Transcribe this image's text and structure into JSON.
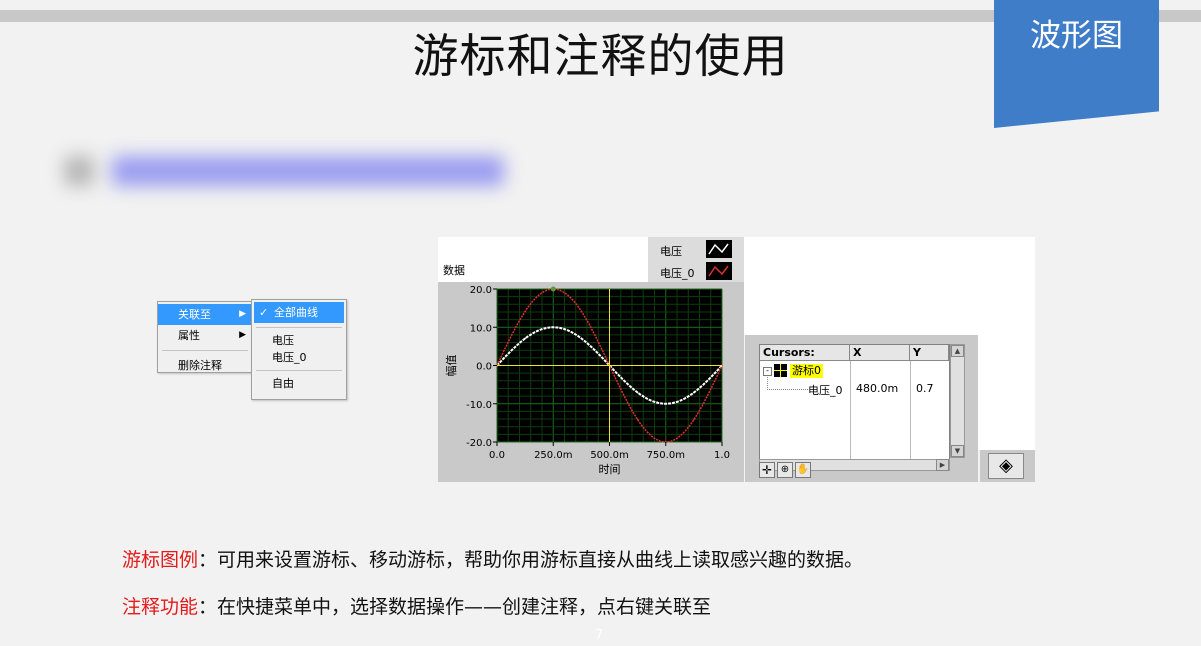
{
  "slide": {
    "title": "游标和注释的使用",
    "tag": "波形图",
    "page_number": "7"
  },
  "context_menu": {
    "items": [
      "关联至",
      "属性",
      "删除注释"
    ],
    "submenu": [
      "全部曲线",
      "电压",
      "电压_0",
      "自由"
    ]
  },
  "graph": {
    "data_label": "数据",
    "legend": [
      {
        "name": "电压",
        "color": "#ffffff"
      },
      {
        "name": "电压_0",
        "color": "#e03030"
      }
    ],
    "x_label": "时间",
    "y_label": "幅值",
    "y_ticks": [
      "20.0",
      "10.0",
      "0.0",
      "-10.0",
      "-20.0"
    ],
    "x_ticks": [
      "0.0",
      "250.0m",
      "500.0m",
      "750.0m",
      "1.0"
    ]
  },
  "chart_data": {
    "type": "line",
    "xlabel": "时间",
    "ylabel": "幅值",
    "xlim": [
      0,
      1
    ],
    "ylim": [
      -20,
      20
    ],
    "grid": true,
    "series": [
      {
        "name": "电压",
        "x": [
          0,
          0.125,
          0.25,
          0.375,
          0.5,
          0.625,
          0.75,
          0.875,
          1.0
        ],
        "values": [
          0,
          7.1,
          10,
          7.1,
          0,
          -7.1,
          -10,
          -7.1,
          0
        ],
        "color": "#ffffff"
      },
      {
        "name": "电压_0",
        "x": [
          0,
          0.125,
          0.25,
          0.375,
          0.5,
          0.625,
          0.75,
          0.875,
          1.0
        ],
        "values": [
          0,
          14.1,
          20,
          14.1,
          0,
          -14.1,
          -20,
          -14.1,
          0
        ],
        "color": "#e03030"
      }
    ],
    "cursor": {
      "x": 0.5,
      "y": 0
    }
  },
  "cursors_legend": {
    "headers": [
      "Cursors:",
      "X",
      "Y"
    ],
    "cursor_name": "游标0",
    "row": {
      "name": "电压_0",
      "x": "480.0m",
      "y": "0.7"
    }
  },
  "descriptions": [
    {
      "key": "游标图例",
      "text": "：可用来设置游标、移动游标，帮助你用游标直接从曲线上读取感兴趣的数据。"
    },
    {
      "key": "注释功能",
      "text": "：在快捷菜单中，选择数据操作——创建注释，点右键关联至"
    }
  ]
}
